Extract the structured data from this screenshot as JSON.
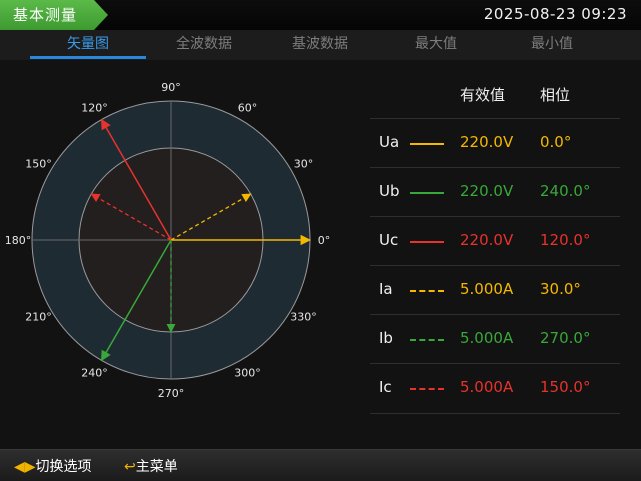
{
  "header": {
    "title": "基本测量",
    "datetime": "2025-08-23  09:23"
  },
  "tabs": [
    {
      "label": "矢量图",
      "active": true
    },
    {
      "label": "全波数据",
      "active": false
    },
    {
      "label": "基波数据",
      "active": false
    },
    {
      "label": "最大值",
      "active": false
    },
    {
      "label": "最小值",
      "active": false
    }
  ],
  "diagram": {
    "angle_labels": [
      "0°",
      "30°",
      "60°",
      "90°",
      "120°",
      "150°",
      "180°",
      "210°",
      "240°",
      "270°",
      "300°",
      "330°"
    ],
    "vectors": [
      {
        "name": "Ua",
        "angle": 0,
        "ring": "outer",
        "style": "solid",
        "color": "#f5b800"
      },
      {
        "name": "Ub",
        "angle": 240,
        "ring": "outer",
        "style": "solid",
        "color": "#39a83a"
      },
      {
        "name": "Uc",
        "angle": 120,
        "ring": "outer",
        "style": "solid",
        "color": "#e8322c"
      },
      {
        "name": "Ia",
        "angle": 30,
        "ring": "inner",
        "style": "dashed",
        "color": "#f5b800"
      },
      {
        "name": "Ib",
        "angle": 270,
        "ring": "inner",
        "style": "dashed",
        "color": "#39a83a"
      },
      {
        "name": "Ic",
        "angle": 150,
        "ring": "inner",
        "style": "dashed",
        "color": "#e8322c"
      }
    ]
  },
  "table": {
    "headers": {
      "magnitude": "有效值",
      "phase": "相位"
    },
    "rows": [
      {
        "name": "Ua",
        "magnitude": "220.0V",
        "phase": "0.0°",
        "color": "#f5b800",
        "style": "solid"
      },
      {
        "name": "Ub",
        "magnitude": "220.0V",
        "phase": "240.0°",
        "color": "#39a83a",
        "style": "solid"
      },
      {
        "name": "Uc",
        "magnitude": "220.0V",
        "phase": "120.0°",
        "color": "#e8322c",
        "style": "solid"
      },
      {
        "name": "Ia",
        "magnitude": "5.000A",
        "phase": "30.0°",
        "color": "#f5b800",
        "style": "dashed"
      },
      {
        "name": "Ib",
        "magnitude": "5.000A",
        "phase": "270.0°",
        "color": "#39a83a",
        "style": "dashed"
      },
      {
        "name": "Ic",
        "magnitude": "5.000A",
        "phase": "150.0°",
        "color": "#e8322c",
        "style": "dashed"
      }
    ]
  },
  "footer": {
    "switch_label": "切换选项",
    "menu_label": "主菜单"
  },
  "colors": {
    "accent": "#2a86d8",
    "title_green": "#4caf3c"
  }
}
